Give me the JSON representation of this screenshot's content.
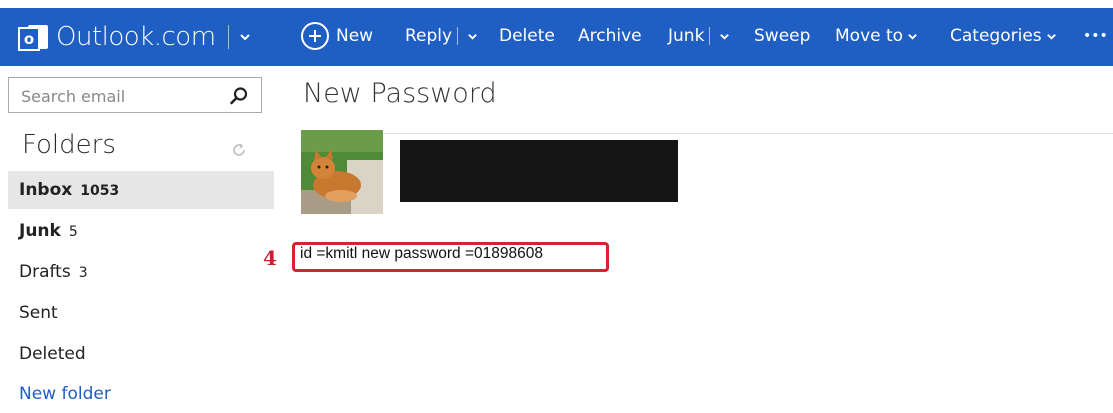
{
  "brand": {
    "logo_letter": "o",
    "name": "Outlook.com"
  },
  "toolbar": {
    "new_label": "New",
    "reply_label": "Reply",
    "delete_label": "Delete",
    "archive_label": "Archive",
    "junk_label": "Junk",
    "sweep_label": "Sweep",
    "move_to_label": "Move to",
    "categories_label": "Categories",
    "more_label": "•••"
  },
  "search": {
    "placeholder": "Search email"
  },
  "sidebar": {
    "title": "Folders",
    "items": [
      {
        "label": "Inbox",
        "count": "1053"
      },
      {
        "label": "Junk",
        "count": "5"
      },
      {
        "label": "Drafts",
        "count": "3"
      },
      {
        "label": "Sent",
        "count": ""
      },
      {
        "label": "Deleted",
        "count": ""
      },
      {
        "label": "New folder",
        "count": ""
      }
    ]
  },
  "message": {
    "subject": "New Password",
    "body": "id =kmitl new password =01898608",
    "annotation_number": "4"
  },
  "colors": {
    "topbar": "#1f5ec2",
    "highlight_border": "#d8232f",
    "link": "#1f5ec2"
  }
}
